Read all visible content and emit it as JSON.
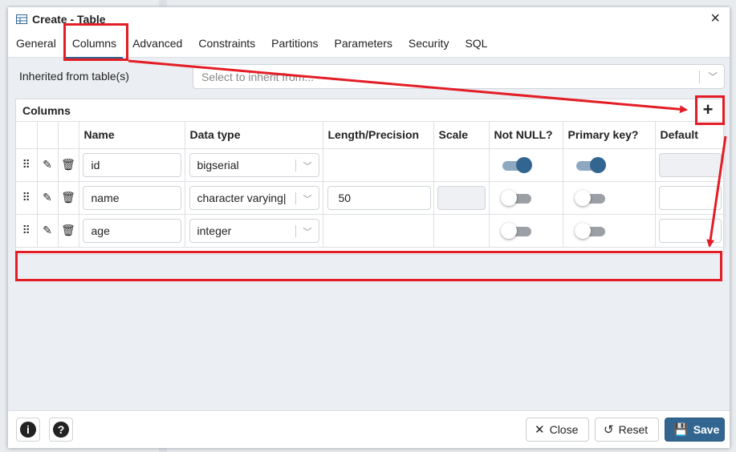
{
  "dialog": {
    "title": "Create - Table",
    "close_symbol": "×",
    "title_icon": "table-icon"
  },
  "tabs": [
    {
      "label": "General"
    },
    {
      "label": "Columns",
      "active": true
    },
    {
      "label": "Advanced"
    },
    {
      "label": "Constraints"
    },
    {
      "label": "Partitions"
    },
    {
      "label": "Parameters"
    },
    {
      "label": "Security"
    },
    {
      "label": "SQL"
    }
  ],
  "inherit": {
    "label": "Inherited from table(s)",
    "placeholder": "Select to inherit from..."
  },
  "columns_panel": {
    "title": "Columns",
    "add_symbol": "+",
    "headers": [
      "Name",
      "Data type",
      "Length/Precision",
      "Scale",
      "Not NULL?",
      "Primary key?",
      "Default"
    ],
    "rows": [
      {
        "name": "id",
        "data_type": "bigserial",
        "length": "",
        "not_null": true,
        "primary_key": true,
        "length_enabled": false,
        "scale_enabled": false,
        "default_enabled": false
      },
      {
        "name": "name",
        "data_type": "character varying|",
        "length": "50",
        "not_null": false,
        "primary_key": false,
        "length_enabled": true,
        "scale_enabled": true,
        "default_enabled": true
      },
      {
        "name": "age",
        "data_type": "integer",
        "length": "",
        "not_null": false,
        "primary_key": false,
        "length_enabled": false,
        "scale_enabled": false,
        "default_enabled": true
      }
    ]
  },
  "footer": {
    "info_symbol": "i",
    "help_symbol": "?",
    "close_label": "Close",
    "reset_label": "Reset",
    "save_label": "Save"
  },
  "colors": {
    "accent": "#326690",
    "highlight": "#e31d25"
  }
}
